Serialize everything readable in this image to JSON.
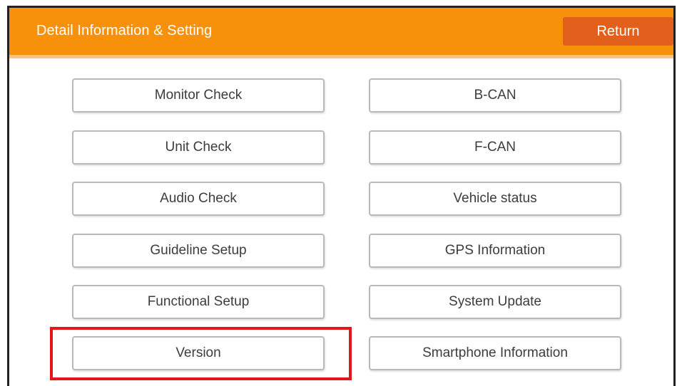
{
  "header": {
    "title": "Detail Information & Setting",
    "return_label": "Return"
  },
  "menu": {
    "left": [
      "Monitor Check",
      "Unit Check",
      "Audio Check",
      "Guideline Setup",
      "Functional Setup",
      "Version"
    ],
    "right": [
      "B-CAN",
      "F-CAN",
      "Vehicle status",
      "GPS Information",
      "System Update",
      "Smartphone Information"
    ]
  },
  "highlighted_item": "Version",
  "colors": {
    "header_bg": "#f7900a",
    "return_bg": "#e2601b",
    "highlight_border": "#e3161b"
  }
}
